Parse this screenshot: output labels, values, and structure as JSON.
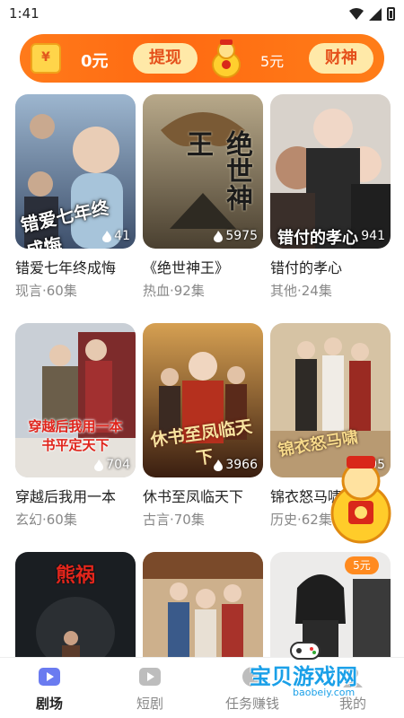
{
  "status": {
    "time": "1:41"
  },
  "banner": {
    "amount": "0元",
    "withdraw_label": "提现",
    "god_amount": "5元",
    "caishen_label": "财神"
  },
  "cards": [
    {
      "title": "错爱七年终成悔",
      "meta": "现言·60集",
      "poster_text": "错爱七年终成悔",
      "plays": "41"
    },
    {
      "title": "《绝世神王》",
      "meta": "热血·92集",
      "poster_text": "绝世神王",
      "plays": "5975"
    },
    {
      "title": "错付的孝心",
      "meta": "其他·24集",
      "poster_text": "错付的孝心",
      "plays": "941"
    },
    {
      "title": "穿越后我用一本",
      "meta": "玄幻·60集",
      "poster_text": "穿越后我用一本书平定天下",
      "plays": "704"
    },
    {
      "title": "休书至凤临天下",
      "meta": "古言·70集",
      "poster_text": "休书至凤临天下",
      "plays": "3966"
    },
    {
      "title": "锦衣怒马啸",
      "meta": "历史·62集",
      "poster_text": "锦衣怒马啸",
      "plays": "905"
    },
    {
      "title": "",
      "meta": "",
      "poster_text": "熊祸",
      "plays": ""
    },
    {
      "title": "",
      "meta": "",
      "poster_text": "",
      "plays": ""
    },
    {
      "title": "",
      "meta": "",
      "poster_text": "",
      "plays": "",
      "badge": "5元"
    }
  ],
  "nav": [
    {
      "label": "剧场",
      "active": true
    },
    {
      "label": "短剧",
      "active": false
    },
    {
      "label": "任务赚钱",
      "active": false
    },
    {
      "label": "我的",
      "active": false
    }
  ],
  "watermark": {
    "text": "宝贝游戏网",
    "url": "baobeiy.com"
  },
  "colors": {
    "accent": "#ff6a12",
    "pill_bg": "#ffe9a8",
    "pill_text": "#e5501b",
    "nav_active": "#222222"
  }
}
